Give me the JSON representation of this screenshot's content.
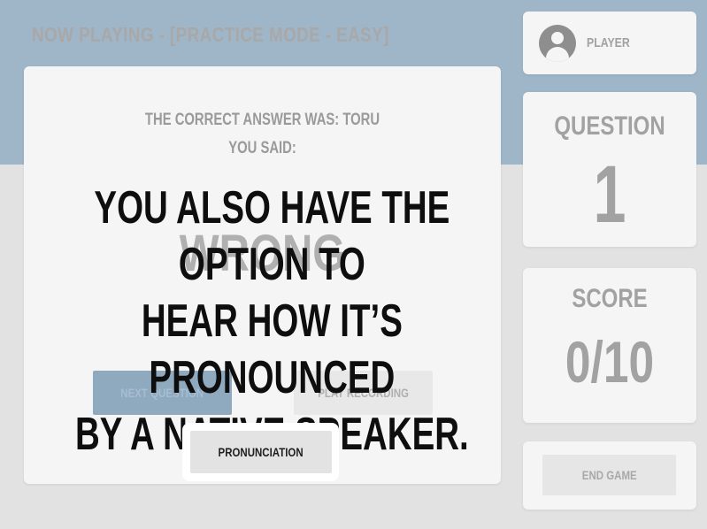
{
  "header": {
    "now_playing": "NOW PLAYING - [PRACTICE MODE - EASY]"
  },
  "result": {
    "correct_answer_line": "THE CORRECT ANSWER WAS: TORU",
    "you_said_line": "YOU SAID:",
    "verdict": "WRONG"
  },
  "buttons": {
    "next_question": "NEXT QUESTION",
    "play_recording": "PLAY RECORDING",
    "pronunciation": "PRONUNCIATION",
    "end_game": "END GAME"
  },
  "sidebar": {
    "player_label": "PLAYER",
    "question_label": "QUESTION",
    "question_number": "1",
    "score_label": "SCORE",
    "score_value": "0/10"
  },
  "tutorial": {
    "line1": "YOU ALSO HAVE THE OPTION TO",
    "line2": "HEAR HOW IT’S PRONOUNCED",
    "line3": "BY A NATIVE SPEAKER."
  },
  "colors": {
    "header_band": "#9fb5c8",
    "card_bg": "#f5f5f5",
    "next_button": "#8fa9bf",
    "tutorial_text": "#0e0e0e"
  },
  "icons": {
    "player_avatar": "user-circle-icon"
  }
}
